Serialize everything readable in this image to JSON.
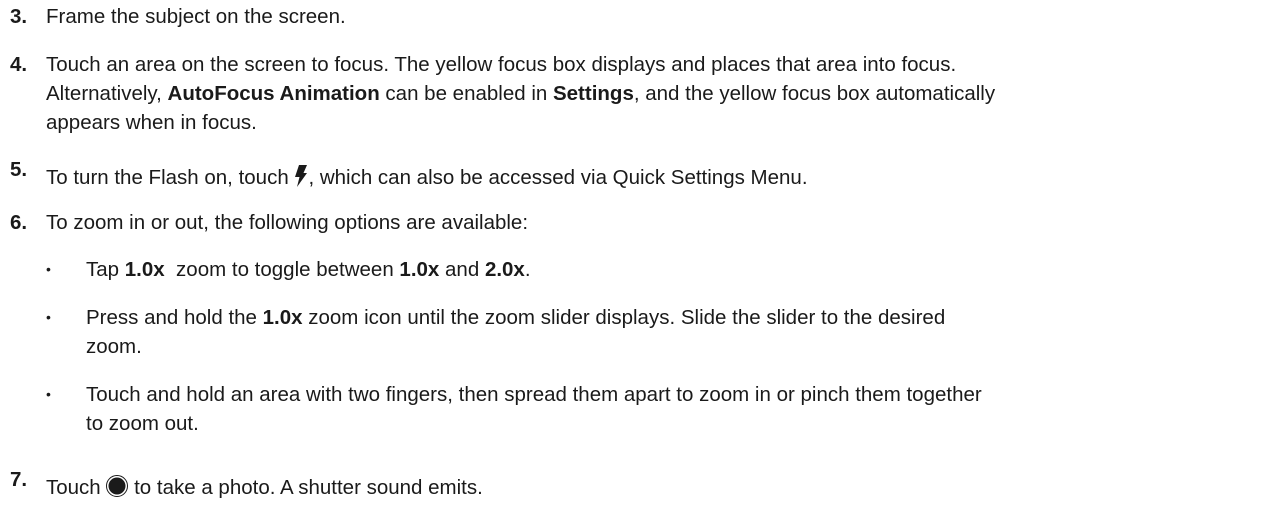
{
  "steps": [
    {
      "number": "3.",
      "parts": [
        "Frame the subject on the screen."
      ]
    },
    {
      "number": "4.",
      "lines": [
        "Touch an area on the screen to focus. The yellow focus box displays and places that area into focus.",
        [
          "Alternatively, ",
          "AutoFocus Animation",
          " can be enabled in ",
          "Settings",
          ", and the yellow focus box automatically"
        ],
        "appears when in focus."
      ]
    },
    {
      "number": "5.",
      "before": "To turn the Flash on, touch ",
      "icon": "flash-icon",
      "after": ", which can also be accessed via Quick Settings Menu."
    },
    {
      "number": "6.",
      "text": "To zoom in or out, the following options are available:"
    },
    {
      "number": "7.",
      "before": "Touch ",
      "icon": "shutter-button-icon",
      "after": " to take a photo. A shutter sound emits."
    }
  ],
  "bullets": [
    {
      "bullet": "•",
      "parts": [
        "Tap ",
        "1.0x",
        "  zoom to toggle between ",
        "1.0x",
        " and ",
        "2.0x",
        "."
      ]
    },
    {
      "bullet": "•",
      "lines": [
        [
          "Press and hold the ",
          "1.0x",
          " zoom icon until the zoom slider displays. Slide the slider to the desired"
        ],
        "zoom."
      ]
    },
    {
      "bullet": "•",
      "lines": [
        "Touch and hold an area with two fingers, then spread them apart to zoom in or pinch them together",
        "to zoom out."
      ]
    }
  ]
}
